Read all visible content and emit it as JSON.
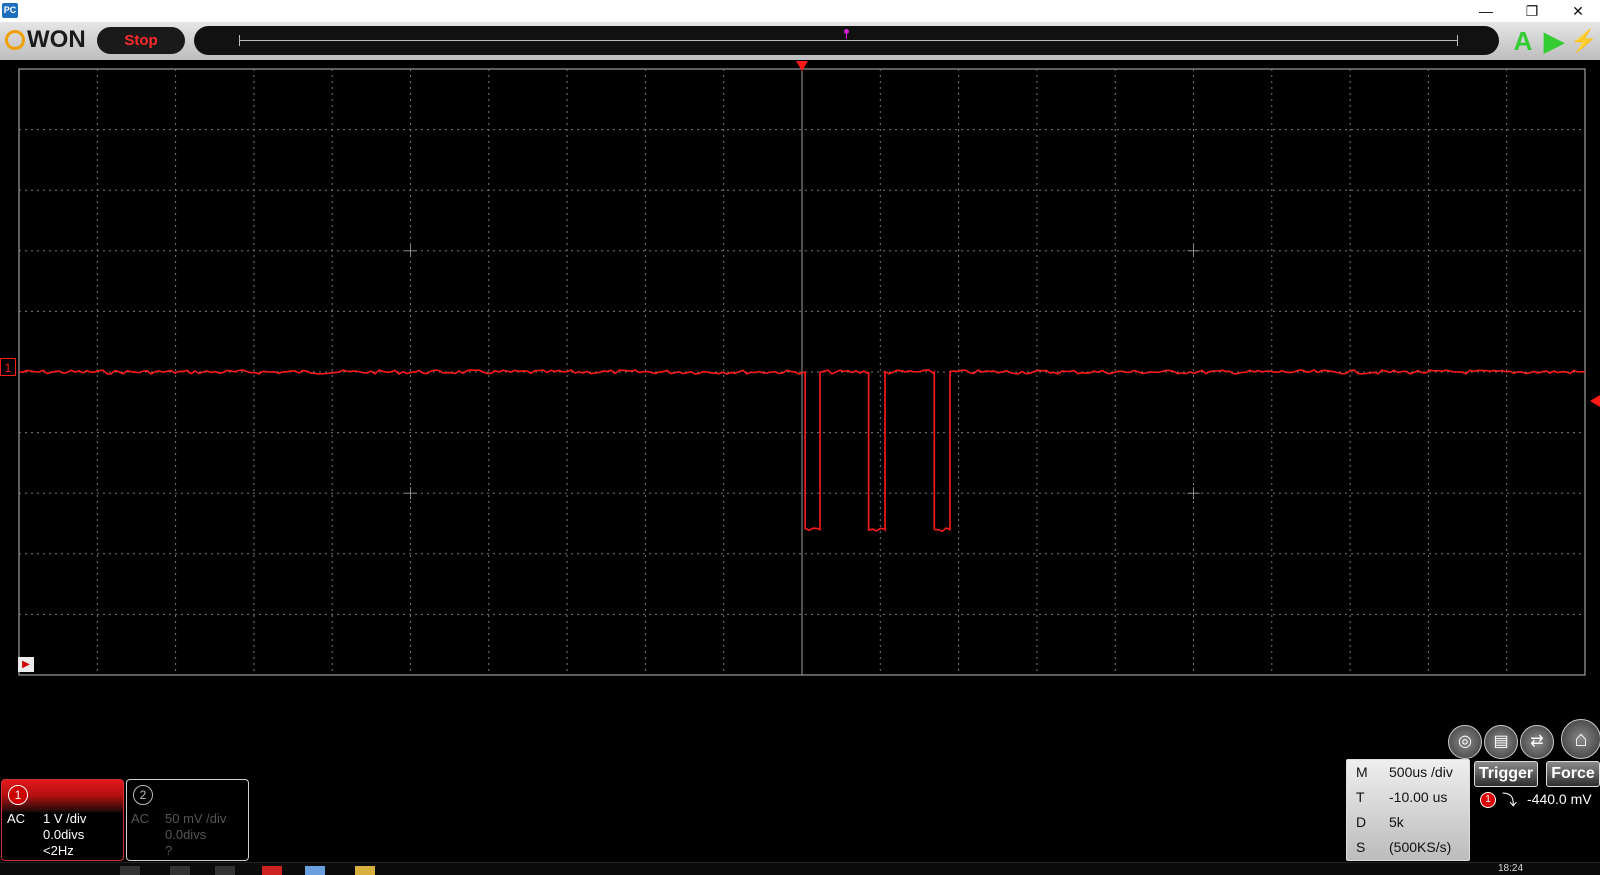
{
  "window": {
    "app_icon_text": "PC",
    "controls": [
      "—",
      "❐",
      "✕"
    ]
  },
  "toolbar": {
    "brand": "WON",
    "run_state_label": "Stop",
    "icons": [
      "auto-set-icon",
      "run-icon",
      "single-trigger-icon"
    ]
  },
  "scope": {
    "grid": {
      "h_divisions": 20,
      "v_divisions": 10
    },
    "trace_color": "#ff1a1a",
    "channel_marker": "1",
    "channel1_level_div": -5,
    "pulse_low_div": -7.6,
    "pulses": [
      {
        "start_div": 10.04,
        "end_div": 10.23
      },
      {
        "start_div": 10.85,
        "end_div": 11.06
      },
      {
        "start_div": 11.69,
        "end_div": 11.89
      }
    ]
  },
  "channels": [
    {
      "number": "1",
      "coupling": "AC",
      "scale": "1 V /div",
      "offset": "0.0divs",
      "freq": "<2Hz",
      "active": true
    },
    {
      "number": "2",
      "coupling": "AC",
      "scale": "50 mV /div",
      "offset": "0.0divs",
      "freq": "?",
      "active": false
    }
  ],
  "timebase": {
    "rows": [
      {
        "key": "M",
        "value": "500us /div"
      },
      {
        "key": "T",
        "value": "-10.00 us"
      },
      {
        "key": "D",
        "value": "5k"
      },
      {
        "key": "S",
        "value": "(500KS/s)"
      }
    ]
  },
  "trigger": {
    "trigger_label": "Trigger",
    "force_label": "Force",
    "source": "1",
    "edge": "falling",
    "level": "-440.0 mV"
  },
  "taskbar": {
    "clock": "18:24"
  }
}
